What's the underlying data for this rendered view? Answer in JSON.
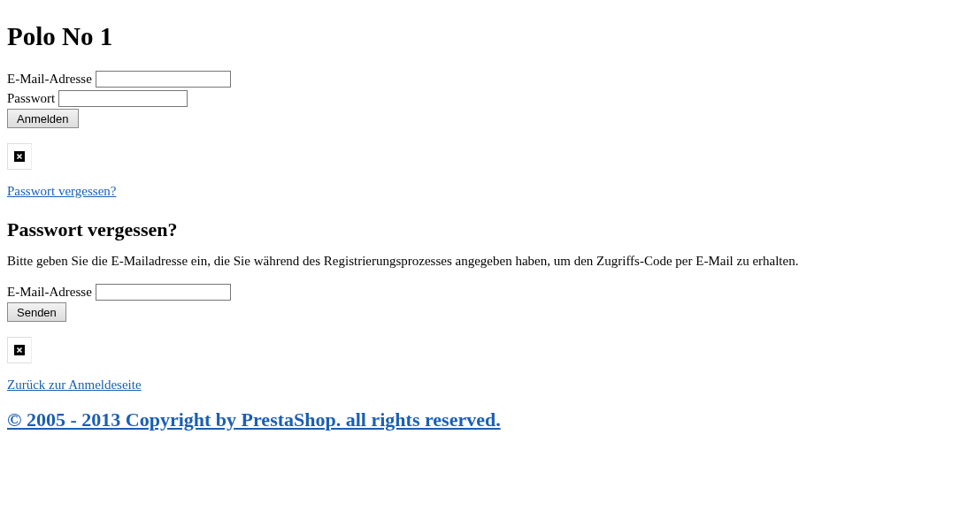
{
  "title": "Polo No 1",
  "login": {
    "email_label": "E-Mail-Adresse",
    "password_label": "Passwort",
    "button": "Anmelden",
    "link": "Passwort vergessen?"
  },
  "forgot": {
    "heading": "Passwort vergessen?",
    "text": "Bitte geben Sie die E-Mailadresse ein, die Sie während des Registrierungsprozesses angegeben haben, um den Zugriffs-Code per E-Mail zu erhalten.",
    "email_label": "E-Mail-Adresse",
    "button": "Senden",
    "link": "Zurück zur Anmeldeseite"
  },
  "footer": "© 2005 - 2013 Copyright by PrestaShop. all rights reserved."
}
